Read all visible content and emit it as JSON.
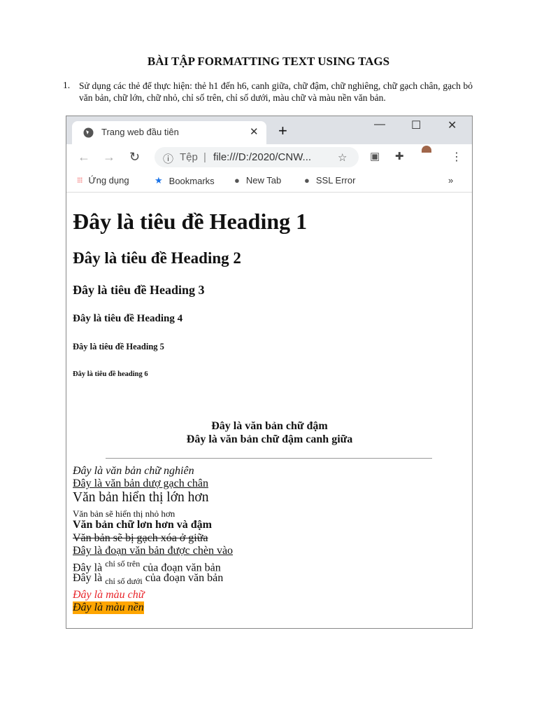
{
  "document": {
    "title": "BÀI TẬP FORMATTING TEXT USING TAGS",
    "task_number": "1.",
    "task_text": "Sử dụng các thẻ để thực hiện: thẻ h1 đến h6, canh giữa, chữ đậm, chữ nghiêng, chữ gạch chân, gạch bỏ văn bản, chữ lớn, chữ nhỏ, chỉ số trên, chỉ số dưới, màu chữ và màu nền văn bản."
  },
  "browser": {
    "tab_title": "Trang web đầu tiên",
    "address_scheme": "Tệp",
    "address_url": "file:///D:/2020/CNW...",
    "bookmarks": [
      "Ứng dụng",
      "Bookmarks",
      "New Tab",
      "SSL Error"
    ],
    "overflow": "»"
  },
  "page": {
    "h1": "Đây là tiêu đề Heading 1",
    "h2": "Đây là tiêu đề Heading 2",
    "h3": "Đây là tiêu đề Heading 3",
    "h4": "Đây là tiêu đề Heading 4",
    "h5": "Đây là tiêu đề Heading 5",
    "h6": "Đây là tiêu đề heading 6",
    "bold": "Đây là văn bản chữ đậm",
    "bold_center": "Đây là văn bản chữ đậm canh giữa",
    "italic": "Đây là văn bản chữ nghiên",
    "underline": "Đây là văn bản dượ gạch chân",
    "big": "Văn bản hiển thị lớn hơn",
    "small": "Văn bản sẽ hiển thị nhỏ hơn",
    "big_bold": "Văn bản chữ lơn hơn và đậm",
    "strike": "Văn bản sẽ bị gạch xóa ở giữa",
    "ins": "Đây là đoạn văn bản được chèn vào",
    "sup_pre": "Đây là",
    "sup": "chỉ số trên",
    "sup_post": "của đoạn văn bản",
    "sub_pre": "Đây là",
    "sub": "chỉ số dưới",
    "sub_post": "của đoạn văn bản",
    "color_text": "Đây là màu chữ",
    "bg_text": "Đây là màu nền"
  },
  "colors": {
    "text_color": "#e8242a",
    "bg_color": "#ffa500"
  }
}
